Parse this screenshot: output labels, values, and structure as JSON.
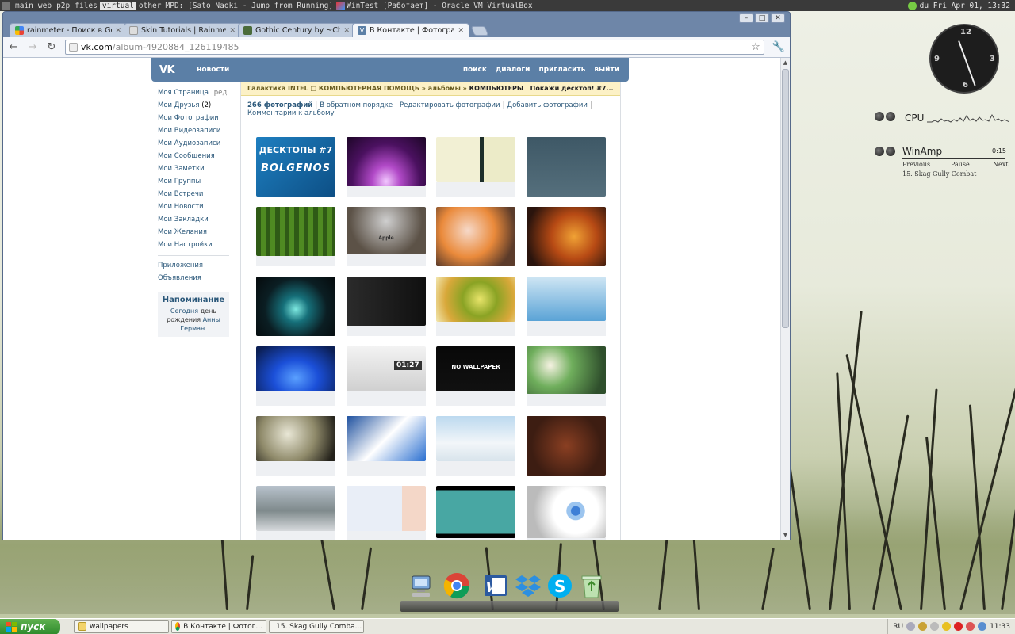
{
  "top_panel": {
    "workspaces": [
      {
        "label": "main",
        "active": false
      },
      {
        "label": "web",
        "active": false
      },
      {
        "label": "p2p",
        "active": false
      },
      {
        "label": "files",
        "active": false
      },
      {
        "label": "virtual",
        "active": true
      },
      {
        "label": "other",
        "active": false
      }
    ],
    "windows": [
      {
        "label": "MPD: [Sato Naoki - Jump from Running]"
      },
      {
        "label": "WinTest [Работает] - Oracle VM VirtualBox"
      }
    ],
    "clock": "du Fri Apr 01, 13:32"
  },
  "browser": {
    "tabs": [
      {
        "label": "rainmeter - Поиск в Google",
        "icon": "google-icon",
        "active": false
      },
      {
        "label": "Skin Tutorials | Rainmeter.net",
        "icon": "page-icon",
        "active": false
      },
      {
        "label": "Gothic Century by ~Chaebi69",
        "icon": "deviantart-icon",
        "active": false
      },
      {
        "label": "В Контакте | Фотографии",
        "icon": "vk-icon",
        "active": true
      }
    ],
    "url_host": "vk.com",
    "url_path": "/album-4920884_126119485"
  },
  "vk": {
    "logo": "VK",
    "news_link": "новости",
    "nav": [
      "поиск",
      "диалоги",
      "пригласить",
      "выйти"
    ],
    "sidebar": {
      "my_page": "Моя Страница",
      "edit": "ред.",
      "items": [
        {
          "label": "Мои Друзья",
          "badge": "(2)"
        },
        {
          "label": "Мои Фотографии"
        },
        {
          "label": "Мои Видеозаписи"
        },
        {
          "label": "Мои Аудиозаписи"
        },
        {
          "label": "Мои Сообщения"
        },
        {
          "label": "Мои Заметки"
        },
        {
          "label": "Мои Группы"
        },
        {
          "label": "Мои Встречи"
        },
        {
          "label": "Мои Новости"
        },
        {
          "label": "Мои Закладки"
        },
        {
          "label": "Мои Желания"
        },
        {
          "label": "Мои Настройки"
        }
      ],
      "extra": [
        "Приложения",
        "Объявления"
      ],
      "reminder": {
        "title": "Напоминание",
        "today": "Сегодня",
        "text1": "день",
        "text2": "рождения",
        "name": "Анны Герман."
      }
    },
    "breadcrumbs": {
      "group": "Галактика INTEL □ КОМПЬЮТЕРНАЯ ПОМОЩЬ",
      "sep1": "»",
      "albums": "альбомы",
      "sep2": "»",
      "current": "КОМПЬЮТЕРЫ | Покажи десктоп! #7..."
    },
    "album_bar": {
      "count": "266 фотографий",
      "links": [
        "В обратном порядке",
        "Редактировать фотографии",
        "Добавить фотографии",
        "Комментарии к альбому"
      ]
    },
    "photo_text": {
      "first_title": "ДЕСКТОПЫ #7",
      "first_sub": "BOLGENOS",
      "no_wallpaper": "NO WALLPAPER",
      "clock_text": "01:27",
      "apple_text": "Apple"
    }
  },
  "rainmeter": {
    "clock_numbers": [
      "12",
      "3",
      "6",
      "9"
    ],
    "cpu_label": "CPU",
    "winamp_title": "WinAmp",
    "winamp_time": "0:15",
    "winamp_prev": "Previous",
    "winamp_pause": "Pause",
    "winamp_next": "Next",
    "winamp_track": "15. Skag Gully Combat"
  },
  "taskbar": {
    "start": "пуск",
    "buttons": [
      {
        "label": "wallpapers",
        "icon": "folder-icon"
      },
      {
        "label": "В Контакте | Фотог...",
        "icon": "chrome-icon"
      },
      {
        "label": "15. Skag Gully Comba...",
        "icon": "winamp-icon"
      }
    ],
    "lang": "RU",
    "time": "11:33"
  },
  "colors": {
    "vk_blue": "#5b7fa6",
    "vk_link": "#2b587a",
    "crumb_bg": "#fcf1c6",
    "xp_green": "#2d8a2c"
  }
}
